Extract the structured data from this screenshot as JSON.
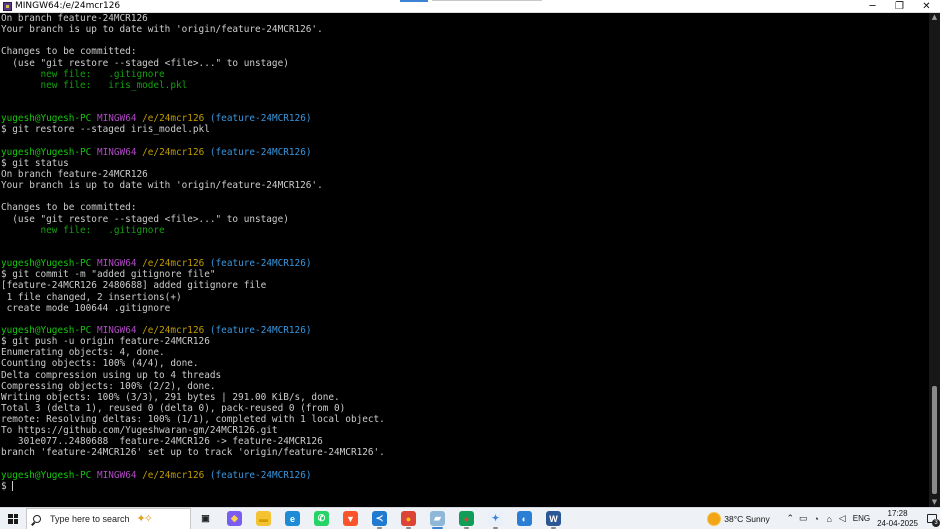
{
  "window": {
    "title": "MINGW64:/e/24mcr126",
    "minimize_glyph": "─",
    "maximize_glyph": "❐",
    "close_glyph": "✕"
  },
  "prompt": {
    "user": "yugesh@Yugesh-PC",
    "host": "MINGW64",
    "path": "/e/24mcr126",
    "branch": "(feature-24MCR126)",
    "symbol": "$"
  },
  "terminal_lines": [
    {
      "type": "text",
      "text": "On branch feature-24MCR126"
    },
    {
      "type": "text",
      "text": "Your branch is up to date with 'origin/feature-24MCR126'."
    },
    {
      "type": "blank"
    },
    {
      "type": "text",
      "text": "Changes to be committed:"
    },
    {
      "type": "text",
      "text": "  (use \"git restore --staged <file>...\" to unstage)"
    },
    {
      "type": "green",
      "text": "\tnew file:   .gitignore"
    },
    {
      "type": "green",
      "text": "\tnew file:   iris_model.pkl"
    },
    {
      "type": "blank"
    },
    {
      "type": "blank"
    },
    {
      "type": "prompt"
    },
    {
      "type": "command",
      "text": "$ git restore --staged iris_model.pkl"
    },
    {
      "type": "blank"
    },
    {
      "type": "prompt"
    },
    {
      "type": "command",
      "text": "$ git status"
    },
    {
      "type": "text",
      "text": "On branch feature-24MCR126"
    },
    {
      "type": "text",
      "text": "Your branch is up to date with 'origin/feature-24MCR126'."
    },
    {
      "type": "blank"
    },
    {
      "type": "text",
      "text": "Changes to be committed:"
    },
    {
      "type": "text",
      "text": "  (use \"git restore --staged <file>...\" to unstage)"
    },
    {
      "type": "green",
      "text": "\tnew file:   .gitignore"
    },
    {
      "type": "blank"
    },
    {
      "type": "blank"
    },
    {
      "type": "prompt"
    },
    {
      "type": "command",
      "text": "$ git commit -m \"added gitignore file\""
    },
    {
      "type": "text",
      "text": "[feature-24MCR126 2480688] added gitignore file"
    },
    {
      "type": "text",
      "text": " 1 file changed, 2 insertions(+)"
    },
    {
      "type": "text",
      "text": " create mode 100644 .gitignore"
    },
    {
      "type": "blank"
    },
    {
      "type": "prompt"
    },
    {
      "type": "command",
      "text": "$ git push -u origin feature-24MCR126"
    },
    {
      "type": "text",
      "text": "Enumerating objects: 4, done."
    },
    {
      "type": "text",
      "text": "Counting objects: 100% (4/4), done."
    },
    {
      "type": "text",
      "text": "Delta compression using up to 4 threads"
    },
    {
      "type": "text",
      "text": "Compressing objects: 100% (2/2), done."
    },
    {
      "type": "text",
      "text": "Writing objects: 100% (3/3), 291 bytes | 291.00 KiB/s, done."
    },
    {
      "type": "text",
      "text": "Total 3 (delta 1), reused 0 (delta 0), pack-reused 0 (from 0)"
    },
    {
      "type": "text",
      "text": "remote: Resolving deltas: 100% (1/1), completed with 1 local object."
    },
    {
      "type": "text",
      "text": "To https://github.com/Yugeshwaran-gm/24MCR126.git"
    },
    {
      "type": "text",
      "text": "   301e077..2480688  feature-24MCR126 -> feature-24MCR126"
    },
    {
      "type": "text",
      "text": "branch 'feature-24MCR126' set up to track 'origin/feature-24MCR126'."
    },
    {
      "type": "blank"
    },
    {
      "type": "prompt"
    },
    {
      "type": "cursor",
      "text": "$ "
    }
  ],
  "taskbar": {
    "search_placeholder": "Type here to search",
    "apps": [
      {
        "name": "task-view-icon",
        "glyph": "▣",
        "bg": "transparent",
        "fg": "#222",
        "state": ""
      },
      {
        "name": "copilot-icon",
        "glyph": "◆",
        "bg": "#7b5cf0",
        "fg": "#ffd34d",
        "state": ""
      },
      {
        "name": "file-explorer-icon",
        "glyph": "▬",
        "bg": "#f3c331",
        "fg": "#d59b00",
        "state": ""
      },
      {
        "name": "edge-icon",
        "glyph": "e",
        "bg": "#1d8bd6",
        "fg": "#fff",
        "state": ""
      },
      {
        "name": "whatsapp-icon",
        "glyph": "✆",
        "bg": "#25d366",
        "fg": "#fff",
        "state": ""
      },
      {
        "name": "brave-icon",
        "glyph": "▼",
        "bg": "#fb542b",
        "fg": "#fff",
        "state": ""
      },
      {
        "name": "vscode-icon",
        "glyph": "≺",
        "bg": "#1f7ad0",
        "fg": "#fff",
        "state": "open"
      },
      {
        "name": "chrome-icon",
        "glyph": "●",
        "bg": "#db4437",
        "fg": "#f4c20d",
        "state": "open"
      },
      {
        "name": "git-bash-terminal-icon",
        "glyph": "▰",
        "bg": "#8fb7d8",
        "fg": "#fff",
        "state": "active"
      },
      {
        "name": "chrome-profile-icon",
        "glyph": "●",
        "bg": "#0f9d58",
        "fg": "#db4437",
        "state": "open"
      },
      {
        "name": "app-launcher-icon",
        "glyph": "✦",
        "bg": "#e8f0fb",
        "fg": "#3c83d6",
        "state": "open"
      },
      {
        "name": "disk-app-icon",
        "glyph": "◐",
        "bg": "#2a7fd4",
        "fg": "#fff",
        "state": ""
      },
      {
        "name": "word-icon",
        "glyph": "W",
        "bg": "#2b5797",
        "fg": "#fff",
        "state": "open"
      }
    ],
    "weather_temp": "38°C",
    "weather_text": "Sunny",
    "tray_glyphs": [
      "⌃",
      "▭",
      "◔",
      "⌂",
      "◁"
    ],
    "language": "ENG",
    "time": "17:28",
    "date": "24-04-2025",
    "notification_count": "3"
  }
}
